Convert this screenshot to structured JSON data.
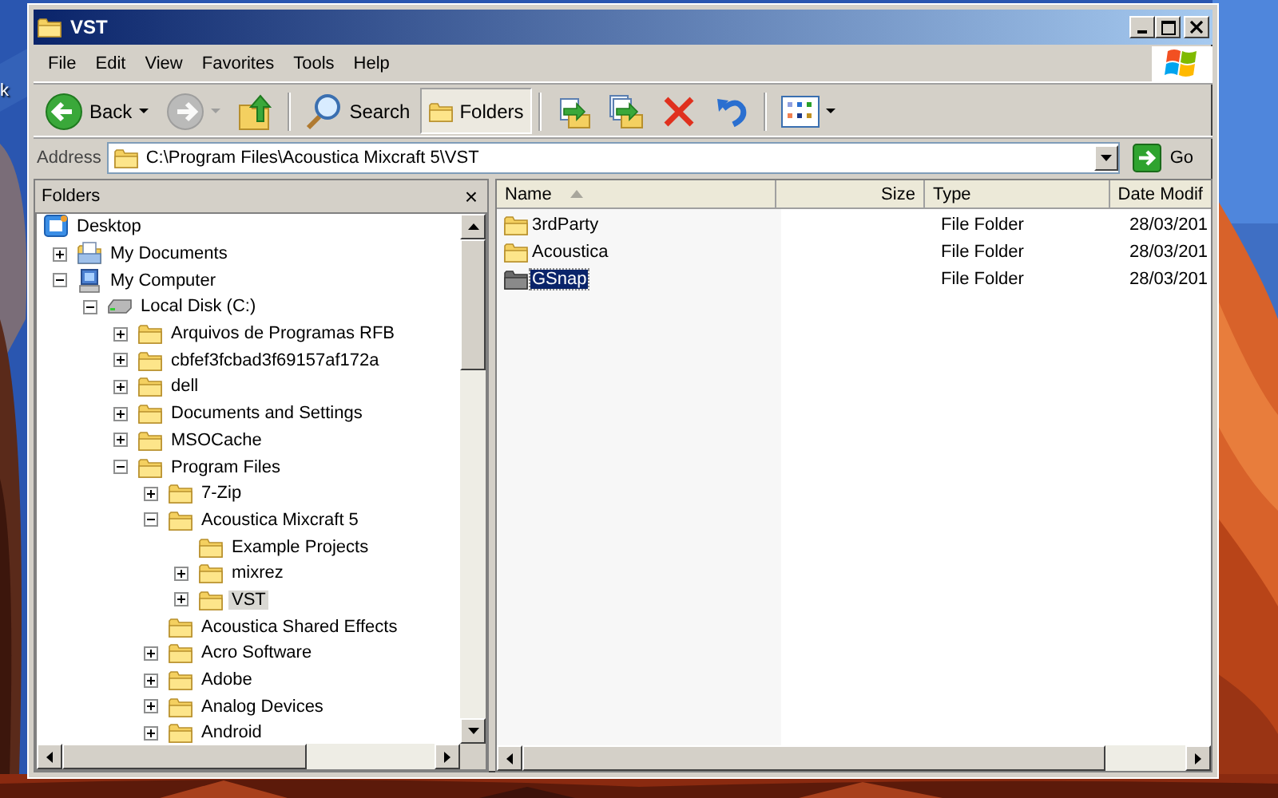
{
  "desktop": {
    "icon_label": "k"
  },
  "window": {
    "title": "VST"
  },
  "menu": [
    "File",
    "Edit",
    "View",
    "Favorites",
    "Tools",
    "Help"
  ],
  "toolbar": {
    "groups": [
      [
        {
          "kind": "back",
          "label": "Back",
          "disabled": false,
          "selected": false
        },
        {
          "kind": "forward",
          "disabled": true,
          "selected": false
        },
        {
          "kind": "up",
          "disabled": false,
          "selected": false
        }
      ],
      [
        {
          "kind": "search",
          "label": "Search",
          "disabled": false,
          "selected": false
        },
        {
          "kind": "folders",
          "label": "Folders",
          "disabled": false,
          "selected": true
        }
      ],
      [
        {
          "kind": "move",
          "disabled": false,
          "selected": false
        },
        {
          "kind": "copy",
          "disabled": false,
          "selected": false
        },
        {
          "kind": "delete",
          "disabled": false,
          "selected": false
        },
        {
          "kind": "undo",
          "disabled": false,
          "selected": false
        }
      ],
      [
        {
          "kind": "views",
          "disabled": false,
          "selected": false
        }
      ]
    ]
  },
  "address": {
    "label": "Address",
    "value": "C:\\Program Files\\Acoustica Mixcraft 5\\VST",
    "go": "Go"
  },
  "folders_pane": {
    "title": "Folders",
    "close": "×",
    "tree": [
      {
        "label": "Desktop",
        "kind": "desktop",
        "selected": false,
        "children": [
          {
            "label": "My Documents",
            "kind": "documents",
            "expanded": false,
            "selected": false
          },
          {
            "label": "My Computer",
            "kind": "computer",
            "expanded": true,
            "selected": false,
            "children": [
              {
                "label": "Local Disk (C:)",
                "kind": "drive",
                "expanded": true,
                "selected": false,
                "children": [
                  {
                    "label": "Arquivos de Programas RFB",
                    "kind": "folder",
                    "expanded": false,
                    "selected": false
                  },
                  {
                    "label": "cbfef3fcbad3f69157af172a",
                    "kind": "folder",
                    "expanded": false,
                    "selected": false
                  },
                  {
                    "label": "dell",
                    "kind": "folder",
                    "expanded": false,
                    "selected": false
                  },
                  {
                    "label": "Documents and Settings",
                    "kind": "folder",
                    "expanded": false,
                    "selected": false
                  },
                  {
                    "label": "MSOCache",
                    "kind": "folder",
                    "expanded": false,
                    "selected": false
                  },
                  {
                    "label": "Program Files",
                    "kind": "folder",
                    "expanded": true,
                    "selected": false,
                    "children": [
                      {
                        "label": "7-Zip",
                        "kind": "folder",
                        "expanded": false,
                        "selected": false
                      },
                      {
                        "label": "Acoustica Mixcraft 5",
                        "kind": "folder",
                        "expanded": true,
                        "selected": false,
                        "children": [
                          {
                            "label": "Example Projects",
                            "kind": "folder",
                            "selected": false
                          },
                          {
                            "label": "mixrez",
                            "kind": "folder",
                            "expanded": false,
                            "selected": false
                          },
                          {
                            "label": "VST",
                            "kind": "folder",
                            "expanded": false,
                            "selected": true
                          }
                        ]
                      },
                      {
                        "label": "Acoustica Shared Effects",
                        "kind": "folder",
                        "selected": false
                      },
                      {
                        "label": "Acro Software",
                        "kind": "folder",
                        "expanded": false,
                        "selected": false
                      },
                      {
                        "label": "Adobe",
                        "kind": "folder",
                        "expanded": false,
                        "selected": false
                      },
                      {
                        "label": "Analog Devices",
                        "kind": "folder",
                        "expanded": false,
                        "selected": false
                      },
                      {
                        "label": "Android",
                        "kind": "folder",
                        "expanded": false,
                        "selected": false
                      }
                    ]
                  }
                ]
              }
            ]
          }
        ]
      }
    ]
  },
  "file_list": {
    "columns": [
      {
        "label": "Name",
        "sorted": true
      },
      {
        "label": "Size",
        "sorted": false
      },
      {
        "label": "Type",
        "sorted": false
      },
      {
        "label": "Date Modif",
        "sorted": false
      }
    ],
    "rows": [
      {
        "name": "3rdParty",
        "type": "File Folder",
        "date": "28/03/201",
        "selected": false
      },
      {
        "name": "Acoustica",
        "type": "File Folder",
        "date": "28/03/201",
        "selected": false
      },
      {
        "name": "GSnap",
        "type": "File Folder",
        "date": "28/03/201",
        "selected": true
      }
    ]
  }
}
